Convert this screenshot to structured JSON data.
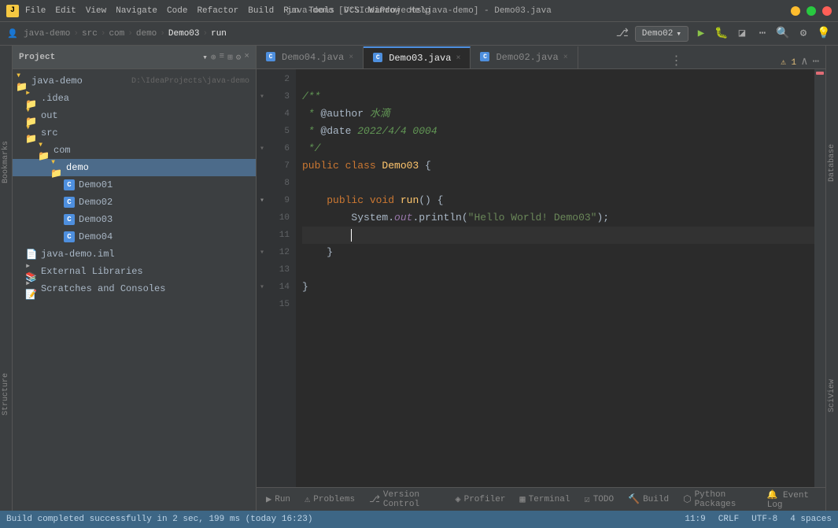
{
  "titleBar": {
    "appIcon": "J",
    "menus": [
      "File",
      "Edit",
      "View",
      "Navigate",
      "Code",
      "Refactor",
      "Build",
      "Run",
      "Tools",
      "VCS",
      "Window",
      "Help"
    ],
    "title": "java-demo [D:\\IdeaProjects\\java-demo] - Demo03.java",
    "winControls": [
      "minimize",
      "maximize",
      "close"
    ]
  },
  "navBar": {
    "breadcrumbs": [
      "java-demo",
      "src",
      "com",
      "demo",
      "Demo03",
      "run"
    ],
    "runConfig": "Demo02"
  },
  "projectPanel": {
    "title": "Project",
    "root": {
      "label": "java-demo",
      "path": "D:\\IdeaProjects\\java-demo",
      "children": [
        {
          "label": ".idea",
          "type": "folder",
          "indent": 1
        },
        {
          "label": "out",
          "type": "folder-open",
          "indent": 1
        },
        {
          "label": "src",
          "type": "folder-open",
          "indent": 1,
          "children": [
            {
              "label": "com",
              "type": "folder-open",
              "indent": 2,
              "children": [
                {
                  "label": "demo",
                  "type": "folder-open",
                  "indent": 3,
                  "selected": true,
                  "children": [
                    {
                      "label": "Demo01",
                      "type": "class",
                      "indent": 4
                    },
                    {
                      "label": "Demo02",
                      "type": "class",
                      "indent": 4
                    },
                    {
                      "label": "Demo03",
                      "type": "class",
                      "indent": 4
                    },
                    {
                      "label": "Demo04",
                      "type": "class",
                      "indent": 4
                    }
                  ]
                }
              ]
            }
          ]
        },
        {
          "label": "java-demo.iml",
          "type": "iml",
          "indent": 1
        },
        {
          "label": "External Libraries",
          "type": "ext",
          "indent": 1
        },
        {
          "label": "Scratches and Consoles",
          "type": "scratch",
          "indent": 1
        }
      ]
    }
  },
  "tabs": [
    {
      "label": "Demo04.java",
      "active": false,
      "modified": false
    },
    {
      "label": "Demo03.java",
      "active": true,
      "modified": false
    },
    {
      "label": "Demo02.java",
      "active": false,
      "modified": false
    }
  ],
  "editorLines": [
    {
      "num": 2,
      "fold": "",
      "content": ""
    },
    {
      "num": 3,
      "fold": "/**",
      "content": "/**"
    },
    {
      "num": 4,
      "fold": "",
      "content": " * @author 水滴"
    },
    {
      "num": 5,
      "fold": "",
      "content": " * @date 2022/4/4 0004"
    },
    {
      "num": 6,
      "fold": "*/",
      "content": " */"
    },
    {
      "num": 7,
      "fold": "",
      "content": "public class Demo03 {"
    },
    {
      "num": 8,
      "fold": "",
      "content": ""
    },
    {
      "num": 9,
      "fold": "run",
      "content": "    public void run() {"
    },
    {
      "num": 10,
      "fold": "",
      "content": "        System.out.println(\"Hello World! Demo03\");"
    },
    {
      "num": 11,
      "fold": "",
      "content": "        ",
      "cursor": true
    },
    {
      "num": 12,
      "fold": "}",
      "content": "    }"
    },
    {
      "num": 13,
      "fold": "",
      "content": ""
    },
    {
      "num": 14,
      "fold": "}",
      "content": "}"
    },
    {
      "num": 15,
      "fold": "",
      "content": ""
    }
  ],
  "bottomTabs": [
    {
      "label": "Run",
      "icon": "▶",
      "active": false
    },
    {
      "label": "Problems",
      "icon": "⚠",
      "active": false
    },
    {
      "label": "Version Control",
      "icon": "⎇",
      "active": false
    },
    {
      "label": "Profiler",
      "icon": "◈",
      "active": false
    },
    {
      "label": "Terminal",
      "icon": "▦",
      "active": false
    },
    {
      "label": "TODO",
      "icon": "☑",
      "active": false
    },
    {
      "label": "Build",
      "icon": "🔨",
      "active": false
    },
    {
      "label": "Python Packages",
      "icon": "⬡",
      "active": false
    }
  ],
  "statusBar": {
    "message": "Build completed successfully in 2 sec, 199 ms (today 16:23)",
    "position": "11:9",
    "encoding": "CRLF",
    "charset": "UTF-8",
    "indent": "4 spaces",
    "eventLog": "Event Log"
  },
  "rightPanelLabels": [
    "Database",
    "SciView"
  ],
  "leftPanelLabels": [
    "Bookmarks",
    "Structure"
  ]
}
